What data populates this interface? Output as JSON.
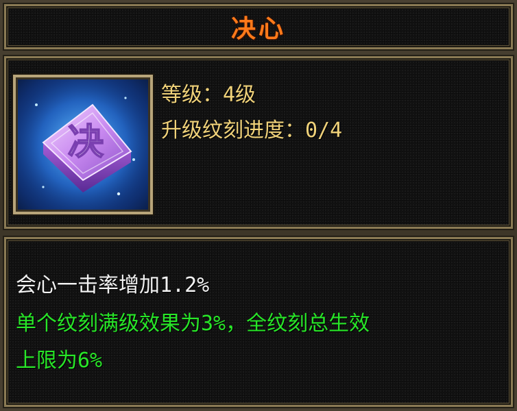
{
  "title": "决心",
  "icon": {
    "name": "jue-rune-icon",
    "glyph": "决"
  },
  "level": {
    "label": "等级：",
    "value": "4级"
  },
  "progress": {
    "label": "升级纹刻进度：",
    "value": "0/4",
    "current": 0,
    "max": 4
  },
  "description": {
    "effect": "会心一击率增加1.2%",
    "note_line1": "单个纹刻满级效果为3%，全纹刻总生效",
    "note_line2": "上限为6%"
  },
  "colors": {
    "title": "#ff7a1a",
    "info_text": "#f0d27a",
    "effect_text": "#f2f2f2",
    "note_text": "#28e628",
    "border": "#8a7a54"
  }
}
